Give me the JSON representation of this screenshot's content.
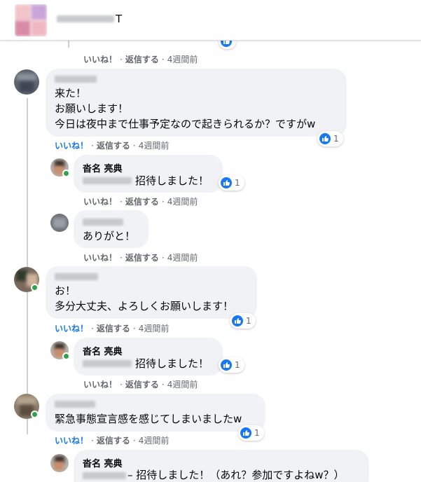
{
  "header": {
    "title_suffix": "T",
    "avatar_icon": "group-avatar-icon"
  },
  "strings": {
    "like": "いいね！",
    "reply": "返信する",
    "time": "4週間前",
    "sep": "·"
  },
  "reaction_icon": "like-thumb-icon",
  "colors": {
    "accent": "#1877f2",
    "bubble": "#f0f2f5",
    "meta": "#65676b",
    "online": "#31a24c"
  },
  "comments": [
    {
      "id": "c1",
      "lines": [
        "来た！",
        "お願いします！",
        "今日は夜中まで仕事予定なので起きられるか？ですがw"
      ],
      "likes": "1",
      "liked": true
    },
    {
      "id": "r1",
      "author": "沓名 亮典",
      "lines": [
        "招待しました！"
      ],
      "likes": "1",
      "liked": false
    },
    {
      "id": "r2",
      "lines": [
        "ありがと！"
      ],
      "liked": false
    },
    {
      "id": "c2",
      "lines": [
        "お！",
        "多分大丈夫、よろしくお願いします！"
      ],
      "likes": "1",
      "liked": true
    },
    {
      "id": "r3",
      "author": "沓名 亮典",
      "lines": [
        "招待しました！"
      ],
      "likes": "1",
      "liked": false
    },
    {
      "id": "c3",
      "lines": [
        "緊急事態宣言感を感じてしまいましたw"
      ],
      "likes": "1",
      "liked": true
    },
    {
      "id": "r4",
      "author": "沓名 亮典",
      "lines": [
        "– 招待しました！（あれ？参加ですよねw？）"
      ],
      "liked": false
    }
  ]
}
